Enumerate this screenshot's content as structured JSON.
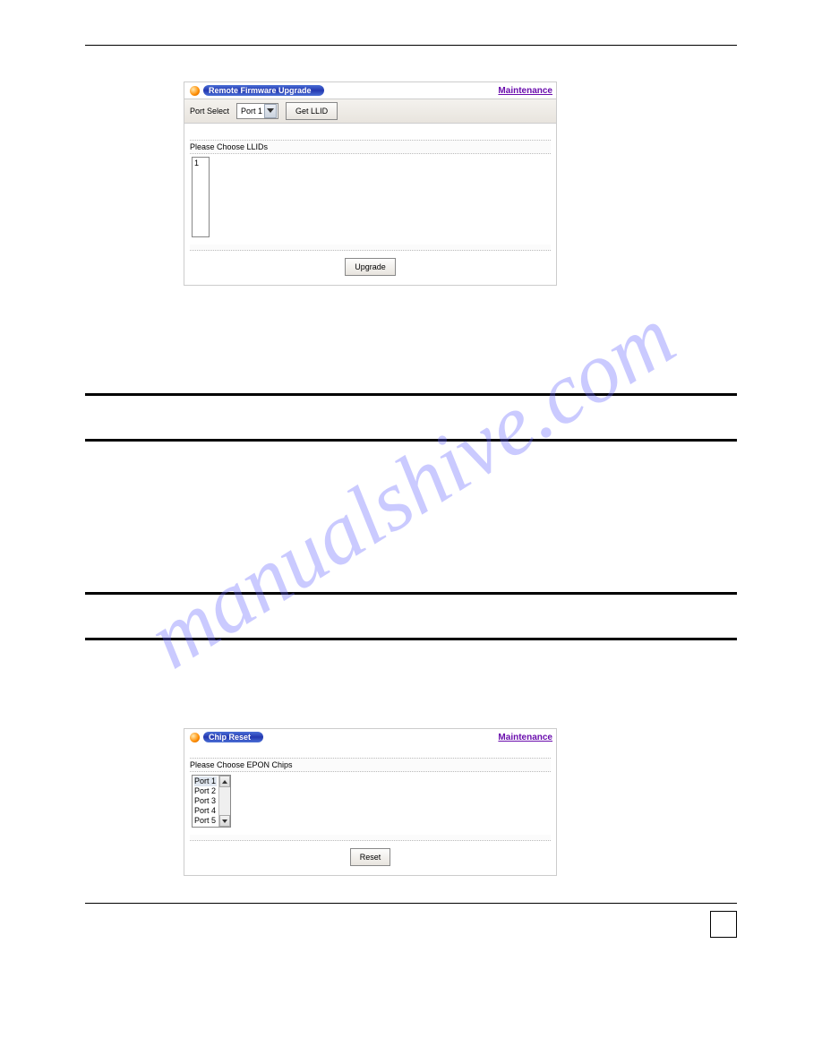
{
  "watermark": "manualshive.com",
  "panel1": {
    "title": "Remote Firmware Upgrade",
    "maintenance": "Maintenance",
    "port_select_label": "Port Select",
    "port_select_value": "Port 1",
    "get_llid_btn": "Get LLID",
    "choose_label": "Please Choose LLIDs",
    "list_item": "1",
    "upgrade_btn": "Upgrade"
  },
  "panel2": {
    "title": "Chip Reset",
    "maintenance": "Maintenance",
    "choose_label": "Please Choose EPON Chips",
    "items": [
      "Port 1",
      "Port 2",
      "Port 3",
      "Port 4",
      "Port 5"
    ],
    "reset_btn": "Reset"
  }
}
